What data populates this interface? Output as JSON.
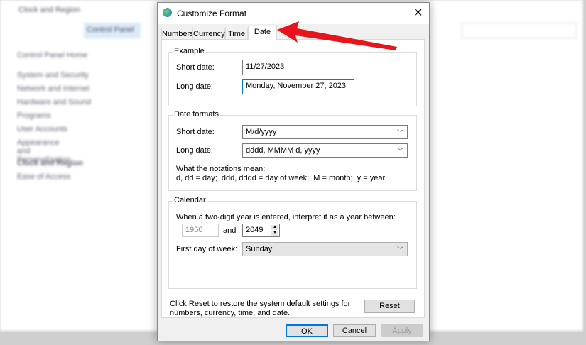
{
  "background": {
    "window_title": "Clock and Region",
    "breadcrumb": "Control Panel",
    "sidebar": [
      "Control Panel Home",
      "System and Security",
      "Network and Internet",
      "Hardware and Sound",
      "Programs",
      "User Accounts",
      "Appearance and Personalization",
      "Clock and Region",
      "Ease of Access"
    ]
  },
  "dialog": {
    "title": "Customize Format",
    "tabs": [
      "Numbers",
      "Currency",
      "Time",
      "Date"
    ],
    "selected_tab": "Date",
    "example": {
      "legend": "Example",
      "short_label": "Short date:",
      "short_value": "11/27/2023",
      "long_label": "Long date:",
      "long_value": "Monday, November 27, 2023"
    },
    "formats": {
      "legend": "Date formats",
      "short_label": "Short date:",
      "short_value": "M/d/yyyy",
      "long_label": "Long date:",
      "long_value": "dddd, MMMM d, yyyy",
      "note_title": "What the notations mean:",
      "note": "d, dd = day;  ddd, dddd = day of week;  M = month;  y = year"
    },
    "calendar": {
      "legend": "Calendar",
      "two_digit_text": "When a two-digit year is entered, interpret it as a year between:",
      "year_start": "1950",
      "and": "and",
      "year_end": "2049",
      "first_day_label": "First day of week:",
      "first_day_value": "Sunday"
    },
    "reset_text_1": "Click Reset to restore the system default settings for",
    "reset_text_2": "numbers, currency, time, and date.",
    "reset": "Reset",
    "ok": "OK",
    "cancel": "Cancel",
    "apply": "Apply"
  },
  "annotation_color": "#e8141b"
}
